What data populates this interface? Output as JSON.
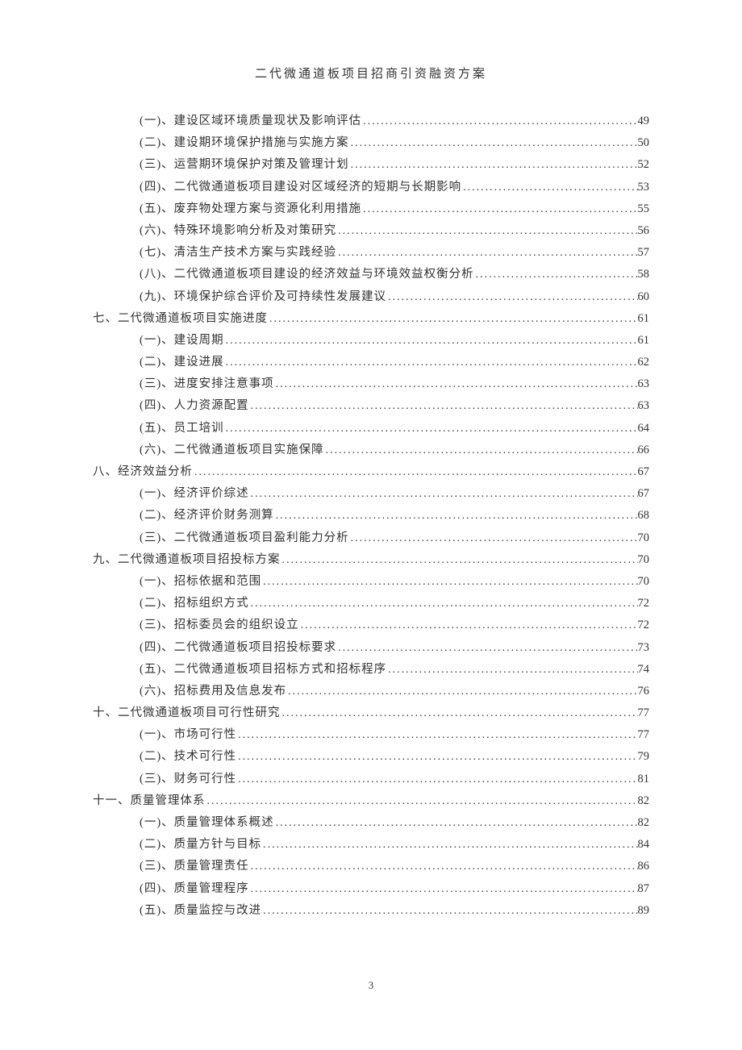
{
  "header": {
    "title": "二代微通道板项目招商引资融资方案"
  },
  "toc": [
    {
      "level": 2,
      "label": "(一)、建设区域环境质量现状及影响评估",
      "page": "49"
    },
    {
      "level": 2,
      "label": "(二)、建设期环境保护措施与实施方案",
      "page": "50"
    },
    {
      "level": 2,
      "label": "(三)、运营期环境保护对策及管理计划",
      "page": "52"
    },
    {
      "level": 2,
      "label": "(四)、二代微通道板项目建设对区域经济的短期与长期影响",
      "page": "53"
    },
    {
      "level": 2,
      "label": "(五)、废弃物处理方案与资源化利用措施",
      "page": "55"
    },
    {
      "level": 2,
      "label": "(六)、特殊环境影响分析及对策研究",
      "page": "56"
    },
    {
      "level": 2,
      "label": "(七)、清洁生产技术方案与实践经验",
      "page": "57"
    },
    {
      "level": 2,
      "label": "(八)、二代微通道板项目建设的经济效益与环境效益权衡分析",
      "page": "58"
    },
    {
      "level": 2,
      "label": "(九)、环境保护综合评价及可持续性发展建议",
      "page": "60"
    },
    {
      "level": 1,
      "label": "七、二代微通道板项目实施进度",
      "page": "61"
    },
    {
      "level": 2,
      "label": "(一)、建设周期",
      "page": "61"
    },
    {
      "level": 2,
      "label": "(二)、建设进展",
      "page": "62"
    },
    {
      "level": 2,
      "label": "(三)、进度安排注意事项",
      "page": "63"
    },
    {
      "level": 2,
      "label": "(四)、人力资源配置",
      "page": "63"
    },
    {
      "level": 2,
      "label": "(五)、员工培训",
      "page": "64"
    },
    {
      "level": 2,
      "label": "(六)、二代微通道板项目实施保障",
      "page": "66"
    },
    {
      "level": 1,
      "label": "八、经济效益分析",
      "page": "67"
    },
    {
      "level": 2,
      "label": "(一)、经济评价综述",
      "page": "67"
    },
    {
      "level": 2,
      "label": "(二)、经济评价财务测算",
      "page": "68"
    },
    {
      "level": 2,
      "label": "(三)、二代微通道板项目盈利能力分析",
      "page": "70"
    },
    {
      "level": 1,
      "label": "九、二代微通道板项目招投标方案",
      "page": "70"
    },
    {
      "level": 2,
      "label": "(一)、招标依据和范围",
      "page": "70"
    },
    {
      "level": 2,
      "label": "(二)、招标组织方式",
      "page": "72"
    },
    {
      "level": 2,
      "label": "(三)、招标委员会的组织设立",
      "page": "72"
    },
    {
      "level": 2,
      "label": "(四)、二代微通道板项目招投标要求",
      "page": "73"
    },
    {
      "level": 2,
      "label": "(五)、二代微通道板项目招标方式和招标程序",
      "page": "74"
    },
    {
      "level": 2,
      "label": "(六)、招标费用及信息发布",
      "page": "76"
    },
    {
      "level": 1,
      "label": "十、二代微通道板项目可行性研究",
      "page": "77"
    },
    {
      "level": 2,
      "label": "(一)、市场可行性",
      "page": "77"
    },
    {
      "level": 2,
      "label": "(二)、技术可行性",
      "page": "79"
    },
    {
      "level": 2,
      "label": "(三)、财务可行性",
      "page": "81"
    },
    {
      "level": 1,
      "label": "十一、质量管理体系",
      "page": "82"
    },
    {
      "level": 2,
      "label": "(一)、质量管理体系概述",
      "page": "82"
    },
    {
      "level": 2,
      "label": "(二)、质量方针与目标",
      "page": "84"
    },
    {
      "level": 2,
      "label": "(三)、质量管理责任",
      "page": "86"
    },
    {
      "level": 2,
      "label": "(四)、质量管理程序",
      "page": "87"
    },
    {
      "level": 2,
      "label": "(五)、质量监控与改进",
      "page": "89"
    }
  ],
  "footer": {
    "pageNumber": "3"
  }
}
